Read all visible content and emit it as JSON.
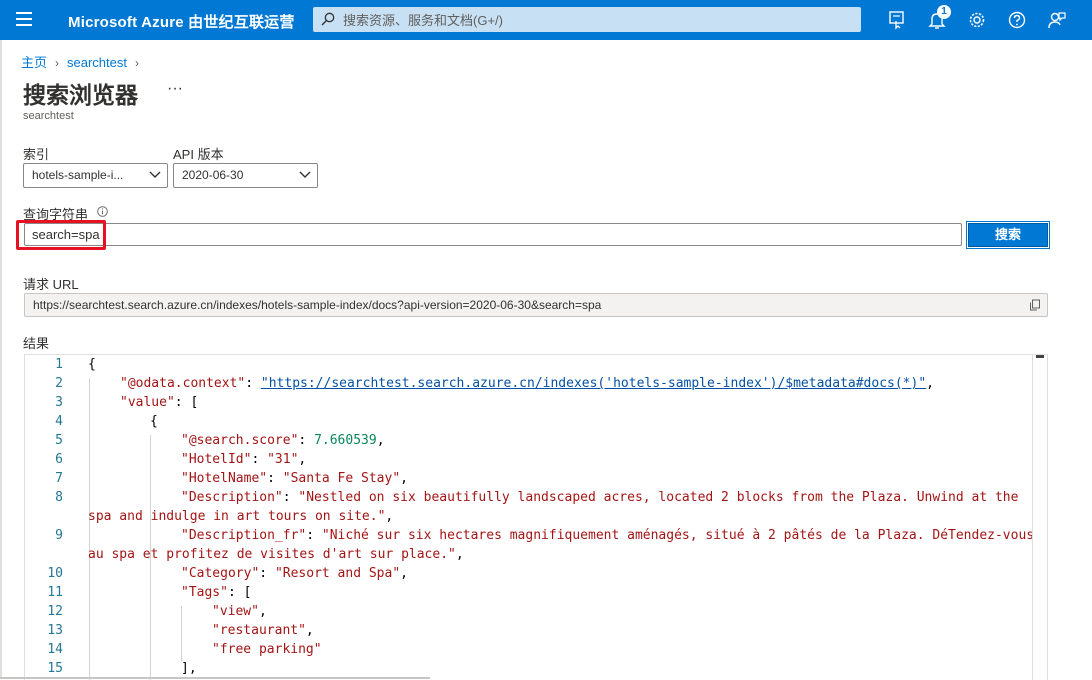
{
  "topbar": {
    "brand": "Microsoft Azure 由世纪互联运营",
    "search_placeholder": "搜索资源、服务和文档(G+/)",
    "notification_count": "1",
    "icons": [
      "feedback-portal-icon",
      "notification-bell-icon",
      "settings-gear-icon",
      "help-question-icon",
      "user-feedback-icon"
    ],
    "accent_color": "#0078d4"
  },
  "breadcrumb": {
    "home": "主页",
    "current": "searchtest"
  },
  "page": {
    "title": "搜索浏览器",
    "more": "···",
    "subtitle": "searchtest"
  },
  "form": {
    "index_label": "索引",
    "index_value": "hotels-sample-i...",
    "api_label": "API 版本",
    "api_value": "2020-06-30",
    "query_label": "查询字符串",
    "query_value": "search=spa",
    "search_button": "搜索",
    "url_label": "请求 URL",
    "url_value": "https://searchtest.search.azure.cn/indexes/hotels-sample-index/docs?api-version=2020-06-30&search=spa",
    "results_label": "结果"
  },
  "results": {
    "line_numbers": [
      "1",
      "2",
      "3",
      "4",
      "5",
      "6",
      "7",
      "8",
      "",
      "9",
      "",
      "10",
      "11",
      "12",
      "13",
      "14",
      "15"
    ],
    "lines": {
      "l1": "{",
      "l2_key": "\"@odata.context\"",
      "l2_sep": ": ",
      "l2_val": "\"https://searchtest.search.azure.cn/indexes('hotels-sample-index')/$metadata#docs(*)\"",
      "l2_end": ",",
      "l3_key": "\"value\"",
      "l3_rest": ": [",
      "l4": "{",
      "l5_key": "\"@search.score\"",
      "l5_sep": ": ",
      "l5_val": "7.660539",
      "l5_end": ",",
      "l6_key": "\"HotelId\"",
      "l6_rest": ": ",
      "l6_val": "\"31\"",
      "l6_end": ",",
      "l7_key": "\"HotelName\"",
      "l7_sep": ": ",
      "l7_val": "\"Santa Fe Stay\"",
      "l7_end": ",",
      "l8_key": "\"Description\"",
      "l8_sep": ": ",
      "l8_val": "\"Nestled on six beautifully landscaped acres, located 2 blocks from the Plaza. Unwind at the",
      "l8_wrap": "spa and indulge in art tours on site.\"",
      "l8_end": ",",
      "l9_key": "\"Description_fr\"",
      "l9_sep": ": ",
      "l9_val": "\"Niché sur six hectares magnifiquement aménagés, situé à 2 pâtés de la Plaza. DéTendez-vous",
      "l9_wrap": "au spa et profitez de visites d'art sur place.\"",
      "l9_end": ",",
      "l10_key": "\"Category\"",
      "l10_sep": ": ",
      "l10_val": "\"Resort and Spa\"",
      "l10_end": ",",
      "l11_key": "\"Tags\"",
      "l11_rest": ": [",
      "l12_val": "\"view\"",
      "l12_end": ",",
      "l13_val": "\"restaurant\"",
      "l13_end": ",",
      "l14_val": "\"free parking\"",
      "l15": "],"
    }
  },
  "highlight_color": "#e81123"
}
